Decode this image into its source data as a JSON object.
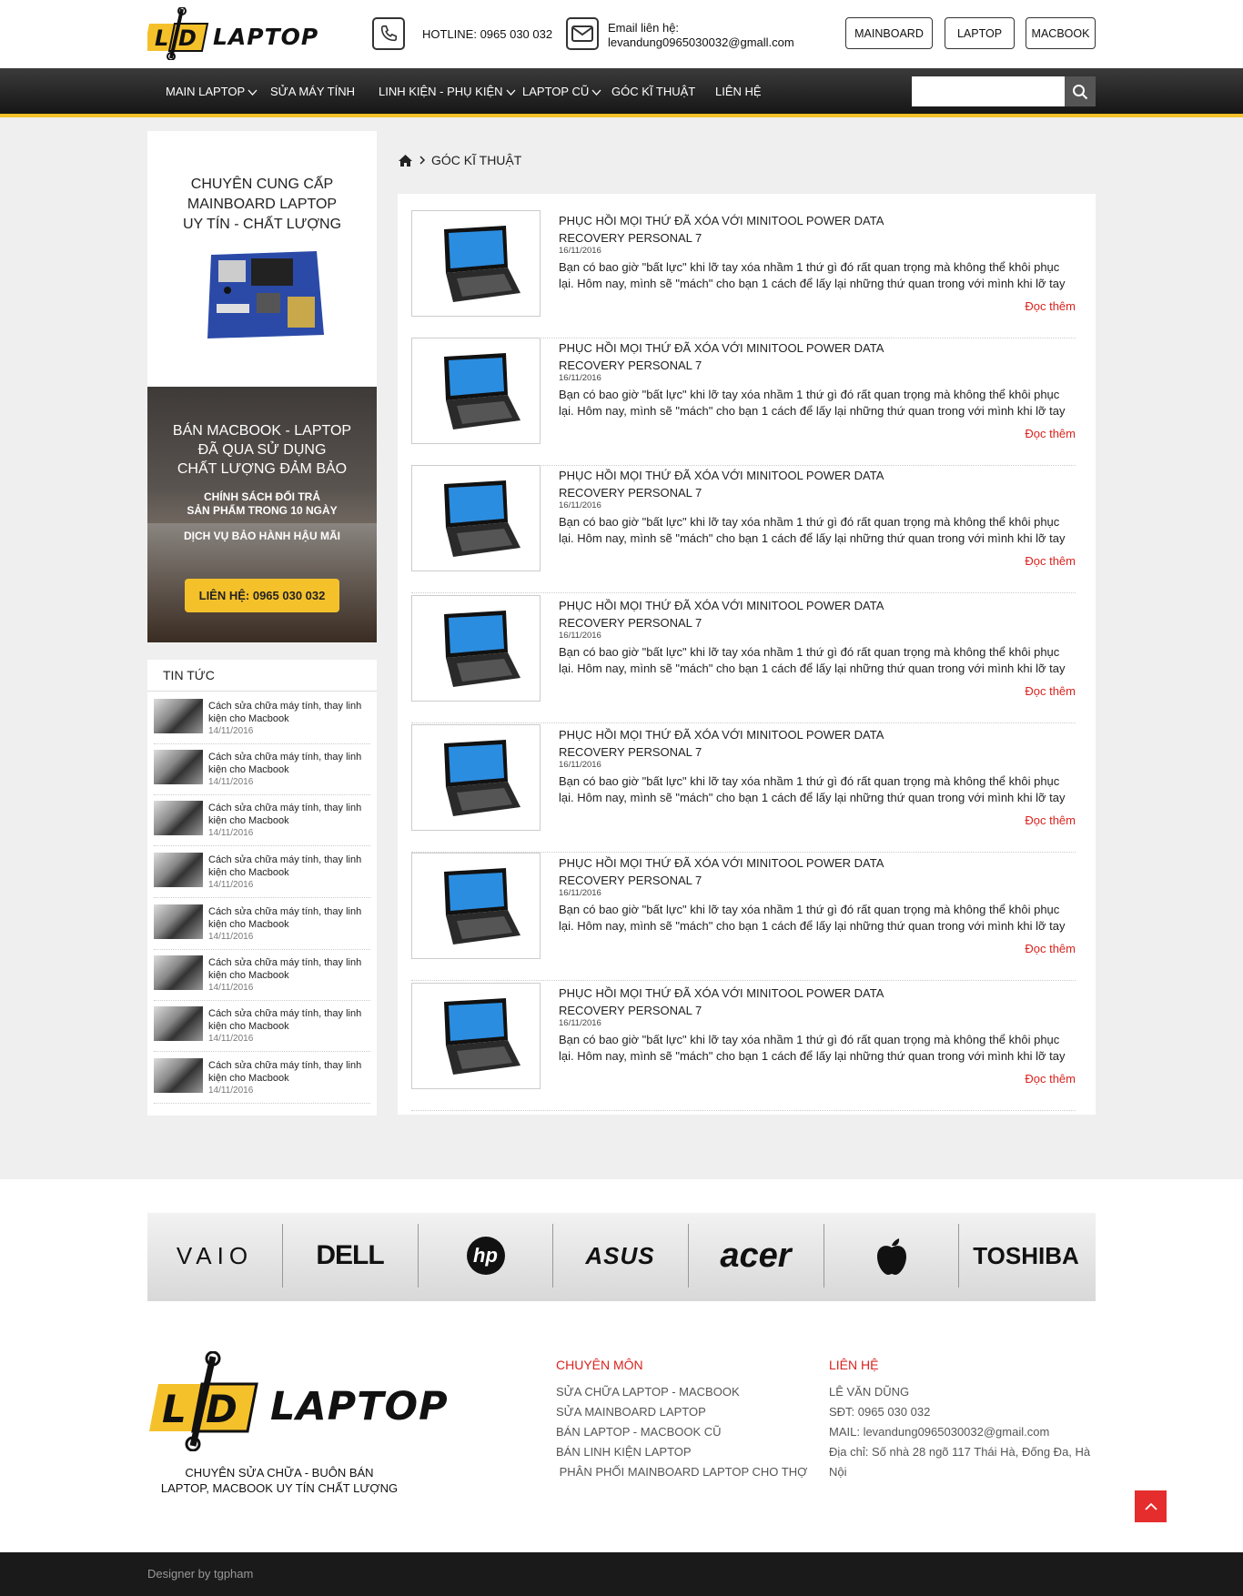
{
  "header": {
    "logo_text": "LAPTOP",
    "logo_mark": "LD",
    "hotline": "HOTLINE: 0965 030 032",
    "email_label": "Email liên hệ:",
    "email_value": "levandung0965030032@gmall.com",
    "buttons": [
      "MAINBOARD",
      "LAPTOP",
      "MACBOOK"
    ]
  },
  "nav": {
    "items": [
      {
        "label": "MAIN LAPTOP",
        "dropdown": true
      },
      {
        "label": "SỬA MÁY TÍNH",
        "dropdown": false
      },
      {
        "label": "LINH KIỆN - PHỤ KIỆN",
        "dropdown": true
      },
      {
        "label": "LAPTOP CŨ",
        "dropdown": true,
        "active": true
      },
      {
        "label": "GÓC KĨ THUẬT",
        "dropdown": false
      },
      {
        "label": "LIÊN HỆ",
        "dropdown": false
      }
    ],
    "search_placeholder": ""
  },
  "sidebar": {
    "promo1": {
      "line1": "CHUYÊN CUNG CẤP",
      "line2": "MAINBOARD LAPTOP",
      "line3": "UY TÍN - CHẤT LƯỢNG"
    },
    "promo2": {
      "line1": "BÁN MACBOOK - LAPTOP",
      "line2": "ĐÃ QUA SỬ DỤNG",
      "line3": "CHẤT LƯỢNG ĐẢM BẢO",
      "policy1": "CHÍNH SÁCH ĐỔI TRẢ",
      "policy2": "SẢN PHẨM TRONG 10 NGÀY",
      "policy3": "DỊCH VỤ BẢO HÀNH HẬU MÃI",
      "cta": "LIÊN HỆ: 0965 030 032"
    },
    "news": {
      "title": "TIN TỨC",
      "items": [
        {
          "title": "Cách sửa chữa máy tính, thay linh kiện cho Macbook",
          "date": "14/11/2016"
        },
        {
          "title": "Cách sửa chữa máy tính, thay linh kiện cho Macbook",
          "date": "14/11/2016"
        },
        {
          "title": "Cách sửa chữa máy tính, thay linh kiện cho Macbook",
          "date": "14/11/2016"
        },
        {
          "title": "Cách sửa chữa máy tính, thay linh kiện cho Macbook",
          "date": "14/11/2016"
        },
        {
          "title": "Cách sửa chữa máy tính, thay linh kiện cho Macbook",
          "date": "14/11/2016"
        },
        {
          "title": "Cách sửa chữa máy tính, thay linh kiện cho Macbook",
          "date": "14/11/2016"
        },
        {
          "title": "Cách sửa chữa máy tính, thay linh kiện cho Macbook",
          "date": "14/11/2016"
        },
        {
          "title": "Cách sửa chữa máy tính, thay linh kiện cho Macbook",
          "date": "14/11/2016"
        }
      ]
    }
  },
  "breadcrumb": {
    "current": "GÓC KĨ THUẬT"
  },
  "posts": [
    {
      "title": "PHỤC HỒI MỌI THỨ ĐÃ XÓA VỚI MINITOOL POWER DATA RECOVERY PERSONAL 7",
      "date": "16/11/2016",
      "excerpt": "Bạn có bao giờ \"bất lực\" khi lỡ tay xóa nhầm 1 thứ gì đó rất quan trọng mà không thể khôi phục lại. Hôm nay, mình sẽ \"mách\" cho bạn 1 cách để lấy lại những thứ quan trong với mình khi lỡ tay xóa",
      "more": "Đọc thêm"
    },
    {
      "title": "PHỤC HỒI MỌI THỨ ĐÃ XÓA VỚI MINITOOL POWER DATA RECOVERY PERSONAL 7",
      "date": "16/11/2016",
      "excerpt": "Bạn có bao giờ \"bất lực\" khi lỡ tay xóa nhầm 1 thứ gì đó rất quan trọng mà không thể khôi phục lại. Hôm nay, mình sẽ \"mách\" cho bạn 1 cách để lấy lại những thứ quan trong với mình khi lỡ tay xóa",
      "more": "Đọc thêm"
    },
    {
      "title": "PHỤC HỒI MỌI THỨ ĐÃ XÓA VỚI MINITOOL POWER DATA RECOVERY PERSONAL 7",
      "date": "16/11/2016",
      "excerpt": "Bạn có bao giờ \"bất lực\" khi lỡ tay xóa nhầm 1 thứ gì đó rất quan trọng mà không thể khôi phục lại. Hôm nay, mình sẽ \"mách\" cho bạn 1 cách để lấy lại những thứ quan trong với mình khi lỡ tay xóa",
      "more": "Đọc thêm"
    },
    {
      "title": "PHỤC HỒI MỌI THỨ ĐÃ XÓA VỚI MINITOOL POWER DATA RECOVERY PERSONAL 7",
      "date": "16/11/2016",
      "excerpt": "Bạn có bao giờ \"bất lực\" khi lỡ tay xóa nhầm 1 thứ gì đó rất quan trọng mà không thể khôi phục lại. Hôm nay, mình sẽ \"mách\" cho bạn 1 cách để lấy lại những thứ quan trong với mình khi lỡ tay xóa",
      "more": "Đọc thêm"
    },
    {
      "title": "PHỤC HỒI MỌI THỨ ĐÃ XÓA VỚI MINITOOL POWER DATA RECOVERY PERSONAL 7",
      "date": "16/11/2016",
      "excerpt": "Bạn có bao giờ \"bất lực\" khi lỡ tay xóa nhầm 1 thứ gì đó rất quan trọng mà không thể khôi phục lại. Hôm nay, mình sẽ \"mách\" cho bạn 1 cách để lấy lại những thứ quan trong với mình khi lỡ tay xóa",
      "more": "Đọc thêm"
    },
    {
      "title": "PHỤC HỒI MỌI THỨ ĐÃ XÓA VỚI MINITOOL POWER DATA RECOVERY PERSONAL 7",
      "date": "16/11/2016",
      "excerpt": "Bạn có bao giờ \"bất lực\" khi lỡ tay xóa nhầm 1 thứ gì đó rất quan trọng mà không thể khôi phục lại. Hôm nay, mình sẽ \"mách\" cho bạn 1 cách để lấy lại những thứ quan trong với mình khi lỡ tay xóa",
      "more": "Đọc thêm"
    },
    {
      "title": "PHỤC HỒI MỌI THỨ ĐÃ XÓA VỚI MINITOOL POWER DATA RECOVERY PERSONAL 7",
      "date": "16/11/2016",
      "excerpt": "Bạn có bao giờ \"bất lực\" khi lỡ tay xóa nhầm 1 thứ gì đó rất quan trọng mà không thể khôi phục lại. Hôm nay, mình sẽ \"mách\" cho bạn 1 cách để lấy lại những thứ quan trong với mình khi lỡ tay xóa",
      "more": "Đọc thêm"
    }
  ],
  "brands": [
    "VAIO",
    "DELL",
    "hp",
    "ASUS",
    "acer",
    "apple",
    "TOSHIBA"
  ],
  "footer": {
    "logo_text": "LAPTOP",
    "tagline1": "CHUYÊN SỬA CHỮA - BUÔN BÁN",
    "tagline2": "LAPTOP, MACBOOK UY TÍN CHẤT LƯỢNG",
    "col1": {
      "title": "CHUYÊN MÔN",
      "items": [
        "SỬA CHỮA LAPTOP - MACBOOK",
        "SỬA MAINBOARD LAPTOP",
        "BÁN LAPTOP - MACBOOK CŨ",
        "BÁN LINH KIỆN LAPTOP",
        " PHÂN PHỐI MAINBOARD LAPTOP CHO THỢ"
      ]
    },
    "col2": {
      "title": "LIÊN HỆ",
      "items": [
        "LÊ VĂN DŨNG",
        "SĐT: 0965 030 032",
        "MAIL: levandung0965030032@gmail.com",
        "Địa chỉ: Số nhà 28 ngõ 117 Thái Hà, Đống Đa, Hà Nội"
      ]
    },
    "credit": "Designer by tgpham"
  },
  "colors": {
    "accent": "#f5c12b",
    "link_red": "#d9231e",
    "nav_dark": "#1e1e1e"
  }
}
